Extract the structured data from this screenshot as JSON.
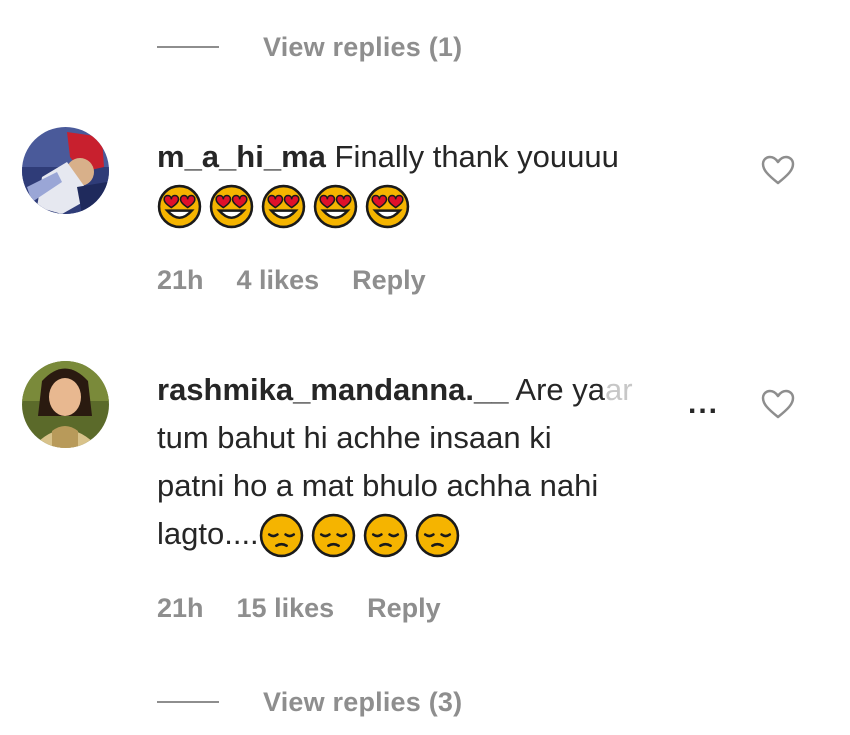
{
  "replies_top": {
    "label": "View replies (1)"
  },
  "comments": [
    {
      "username": "m_a_hi_ma",
      "text": "Finally thank youuuu",
      "emojis": [
        "heart-eyes",
        "heart-eyes",
        "heart-eyes",
        "heart-eyes",
        "heart-eyes"
      ],
      "time": "21h",
      "likes": "4 likes",
      "reply_label": "Reply"
    },
    {
      "username": "rashmika_mandanna.__",
      "text_line1": "Are ya",
      "text_fade": "ar",
      "more": "...",
      "text_line2": "tum bahut hi achhe insaan ki",
      "text_line3": "patni ho a mat bhulo achha nahi",
      "text_line4": "lagto....",
      "emojis": [
        "pensive",
        "pensive",
        "pensive",
        "pensive"
      ],
      "time": "21h",
      "likes": "15 likes",
      "reply_label": "Reply"
    }
  ],
  "replies_bottom": {
    "label": "View replies (3)"
  },
  "colors": {
    "muted": "#8e8e8e",
    "text": "#262626",
    "emoji_yellow": "#f5b400"
  }
}
